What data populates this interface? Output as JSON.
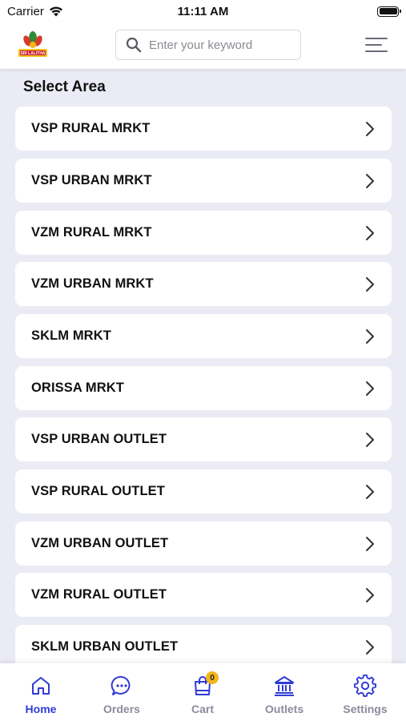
{
  "status_bar": {
    "carrier": "Carrier",
    "time": "11:11 AM"
  },
  "header": {
    "logo_text": "SRI LALITHA",
    "search_placeholder": "Enter your keyword"
  },
  "section_title": "Select Area",
  "areas": [
    "VSP RURAL MRKT",
    "VSP URBAN MRKT",
    "VZM RURAL MRKT",
    "VZM URBAN MRKT",
    "SKLM MRKT",
    "ORISSA MRKT",
    "VSP URBAN OUTLET",
    "VSP RURAL OUTLET",
    "VZM URBAN OUTLET",
    "VZM RURAL OUTLET",
    "SKLM URBAN OUTLET"
  ],
  "bottom_nav": {
    "home": "Home",
    "orders": "Orders",
    "cart": "Cart",
    "cart_count": "0",
    "outlets": "Outlets",
    "settings": "Settings"
  },
  "colors": {
    "accent": "#2f3bd6",
    "inactive": "#8b8b9c",
    "background": "#ebebf5",
    "badge": "#f2b51c"
  }
}
